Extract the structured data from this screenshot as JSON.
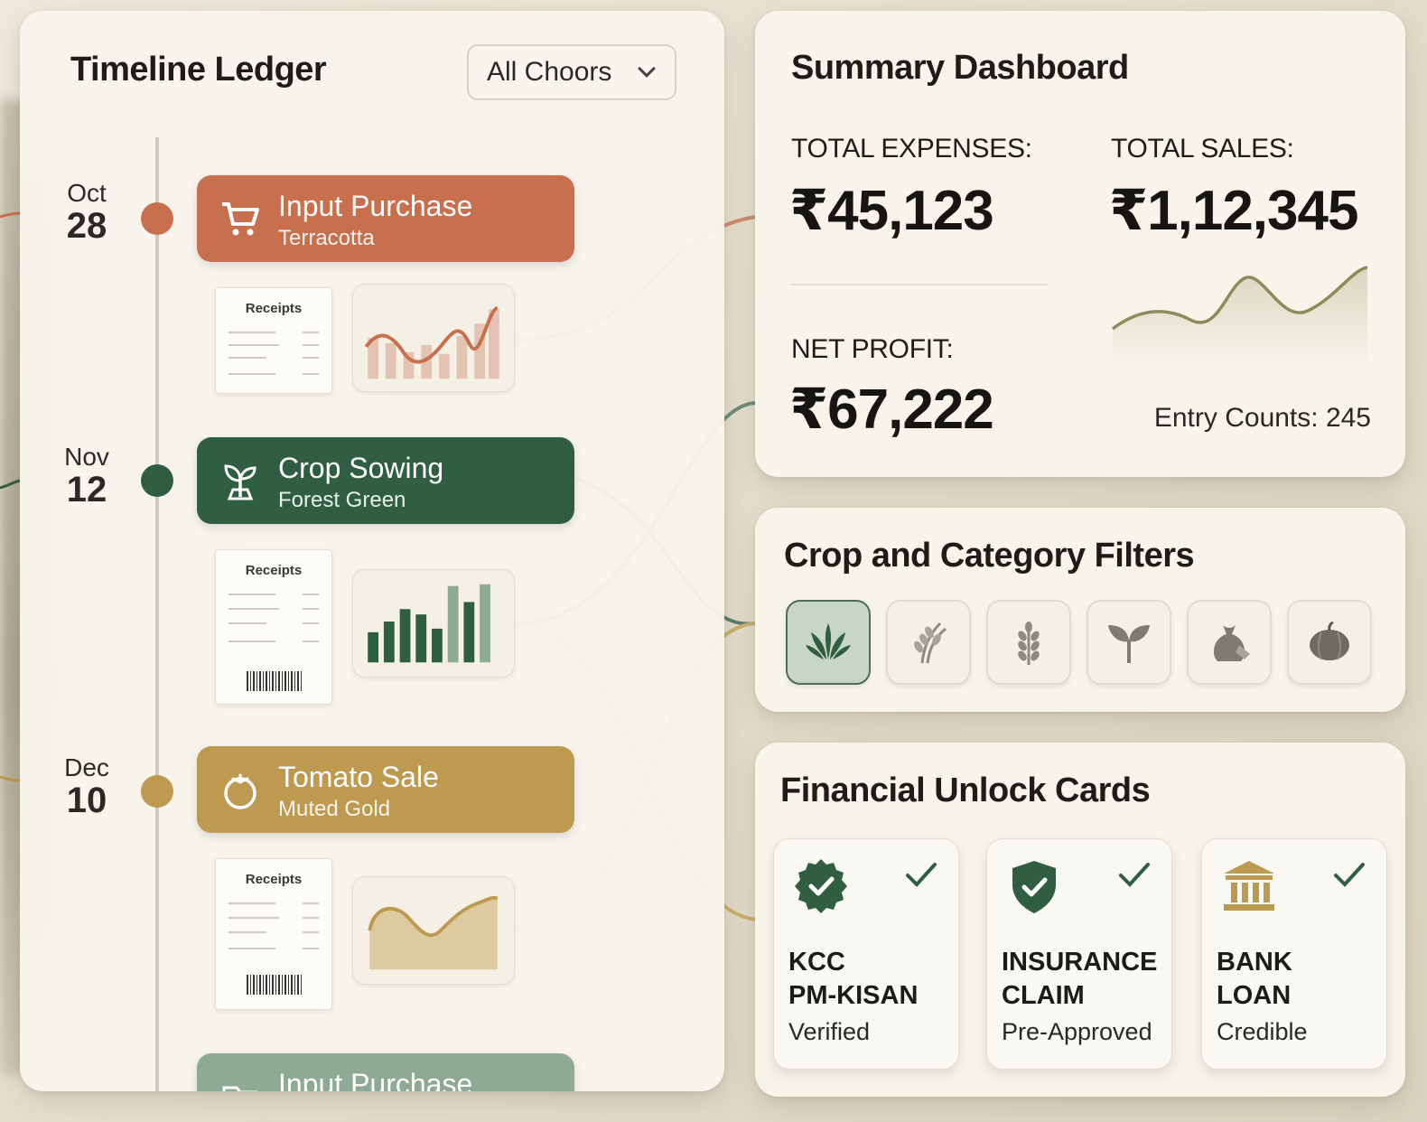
{
  "ledger": {
    "title": "Timeline Ledger",
    "filter_value": "All Choors",
    "entries": [
      {
        "month": "Oct",
        "day": "28",
        "title": "Input Purchase",
        "subtitle": "Terracotta",
        "color": "#c8704e",
        "receipt_label": "Receipts",
        "icon": "cart-icon"
      },
      {
        "month": "Nov",
        "day": "12",
        "title": "Crop Sowing",
        "subtitle": "Forest Green",
        "color": "#2f5e40",
        "receipt_label": "Receipts",
        "icon": "sprout-icon"
      },
      {
        "month": "Dec",
        "day": "10",
        "title": "Tomato Sale",
        "subtitle": "Muted Gold",
        "color": "#bd9a4f",
        "receipt_label": "Receipts",
        "icon": "tomato-icon"
      },
      {
        "title": "Input Purchase",
        "color": "#8faa93",
        "icon": "folder-icon"
      }
    ]
  },
  "summary": {
    "title": "Summary Dashboard",
    "total_expenses_label": "TOTAL EXPENSES:",
    "total_expenses": "₹45,123",
    "total_sales_label": "TOTAL SALES:",
    "total_sales": "₹1,12,345",
    "net_profit_label": "NET PROFIT:",
    "net_profit": "₹67,222",
    "entry_counts": "Entry Counts: 245"
  },
  "filters": {
    "title": "Crop and Category Filters",
    "items": [
      {
        "icon": "aloe-plant-icon",
        "active": true
      },
      {
        "icon": "rice-stalk-icon",
        "active": false
      },
      {
        "icon": "wheat-icon",
        "active": false
      },
      {
        "icon": "seedling-icon",
        "active": false
      },
      {
        "icon": "money-bag-icon",
        "active": false
      },
      {
        "icon": "pumpkin-icon",
        "active": false
      }
    ]
  },
  "unlock": {
    "title": "Financial Unlock Cards",
    "cards": [
      {
        "line1": "KCC",
        "line2": "PM-KISAN",
        "status": "Verified",
        "icon": "verified-badge-icon"
      },
      {
        "line1": "INSURANCE",
        "line2": "CLAIM",
        "status": "Pre-Approved",
        "icon": "shield-check-icon"
      },
      {
        "line1": "BANK",
        "line2": "LOAN",
        "status": "Credible",
        "icon": "bank-icon"
      }
    ]
  },
  "colors": {
    "terracotta": "#c8704e",
    "forest": "#2f5e40",
    "gold": "#bd9a4f",
    "sage": "#8faa93",
    "panel": "#f8f5ed"
  }
}
